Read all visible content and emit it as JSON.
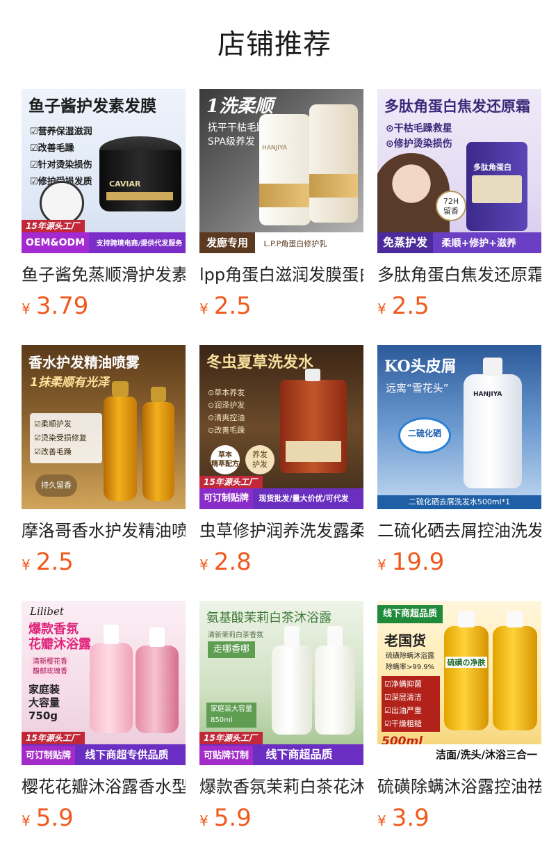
{
  "page": {
    "title": "店铺推荐"
  },
  "products": [
    {
      "name": "鱼子酱免蒸顺滑护发素发膜",
      "currency": "¥",
      "price": "3.79",
      "image": {
        "title": "鱼子酱护发素发膜",
        "lines": "☑营养保湿滋润\n☑改善毛躁\n☑针对烫染损伤\n☑修护受损发质",
        "jar_label": "CAVIAR",
        "tag": "15年源头工厂",
        "bar_left": "OEM&ODM",
        "bar_right": "支持跨境电商/提供代发服务"
      }
    },
    {
      "name": "lpp角蛋白滋润发膜蛋白修护乳",
      "currency": "¥",
      "price": "2.5",
      "image": {
        "title": "1洗柔顺",
        "lines": "抚平干枯毛躁\nSPA级养发",
        "pouch_label": "HANJIYA",
        "bar_left": "发廊专用",
        "bar_right": "L.P.P角蛋白修护乳"
      }
    },
    {
      "name": "多肽角蛋白焦发还原霜修护",
      "currency": "¥",
      "price": "2.5",
      "image": {
        "title": "多肽角蛋白焦发还原霜",
        "lines": "⊙干枯毛躁救星\n⊙修护烫染损伤",
        "pouch_label": "多肽角蛋白",
        "badge": "72H\n留香",
        "bar_left": "免蒸护发",
        "bar_right": "柔顺+修护+滋养"
      }
    },
    {
      "name": "摩洛哥香水护发精油喷雾",
      "currency": "¥",
      "price": "2.5",
      "image": {
        "title": "香水护发精油喷雾",
        "lines": "1抹柔顺有光泽",
        "checks": "☑柔顺护发\n☑烫染受损修复\n☑改善毛躁",
        "badge": "持久留香"
      }
    },
    {
      "name": "虫草修护润养洗发露柔顺",
      "currency": "¥",
      "price": "2.8",
      "image": {
        "title": "冬虫夏草洗发水",
        "lines": "⊙草本养发\n⊙润泽护发\n⊙清爽控油\n⊙改善毛躁",
        "badge": "草本\n精萃配方",
        "badge2": "养发\n护发",
        "tag": "15年源头工厂",
        "bar_left": "可订制贴牌",
        "bar_right": "现货批发/量大价优/可代发"
      }
    },
    {
      "name": "二硫化硒去屑控油洗发水",
      "currency": "¥",
      "price": "19.9",
      "image": {
        "title": "KO头皮屑",
        "lines": "远离“雪花头”",
        "bottle_label": "HANJIYA",
        "badge": "二硫化硒",
        "bar_text": "二硫化硒去屑洗发水500ml*1"
      }
    },
    {
      "name": "樱花花瓣沐浴露香水型",
      "currency": "¥",
      "price": "5.9",
      "image": {
        "brand": "Lilibet",
        "title": "爆款香氛\n花瓣沐浴露",
        "lines": "清新樱花香\n馥郁玫瑰香",
        "size": "家庭装\n大容量\n750g",
        "tag": "15年源头工厂",
        "bar_left": "可订制贴牌",
        "bar_right": "线下商超专供品质"
      }
    },
    {
      "name": "爆款香氛茉莉白茶花沐浴露",
      "currency": "¥",
      "price": "5.9",
      "image": {
        "title": "氨基酸茉莉白茶沐浴露",
        "lines": "清新茉莉白茶香氛",
        "badge": "走哪香哪",
        "size": "家庭装大容量\n850ml",
        "tag": "15年源头工厂",
        "bar_left": "可贴牌订制",
        "bar_right": "线下商超品质"
      }
    },
    {
      "name": "硫磺除螨沐浴露控油祛痘",
      "currency": "¥",
      "price": "3.9",
      "image": {
        "top_tag": "线下商超品质",
        "title": "老国货",
        "lines": "硫磺除螨沐浴露\n除螨率>99.9%",
        "checks": "☑净螨抑菌\n☑深层清洁\n☑出油严重\n☑干燥粗糙",
        "bottle_label": "硫磺の净肤",
        "size": "500ml",
        "bar_right": "洁面/洗头/沐浴三合一"
      }
    }
  ],
  "colors": {
    "price": "#f0591d",
    "title": "#1a1a1a",
    "name": "#222222"
  }
}
